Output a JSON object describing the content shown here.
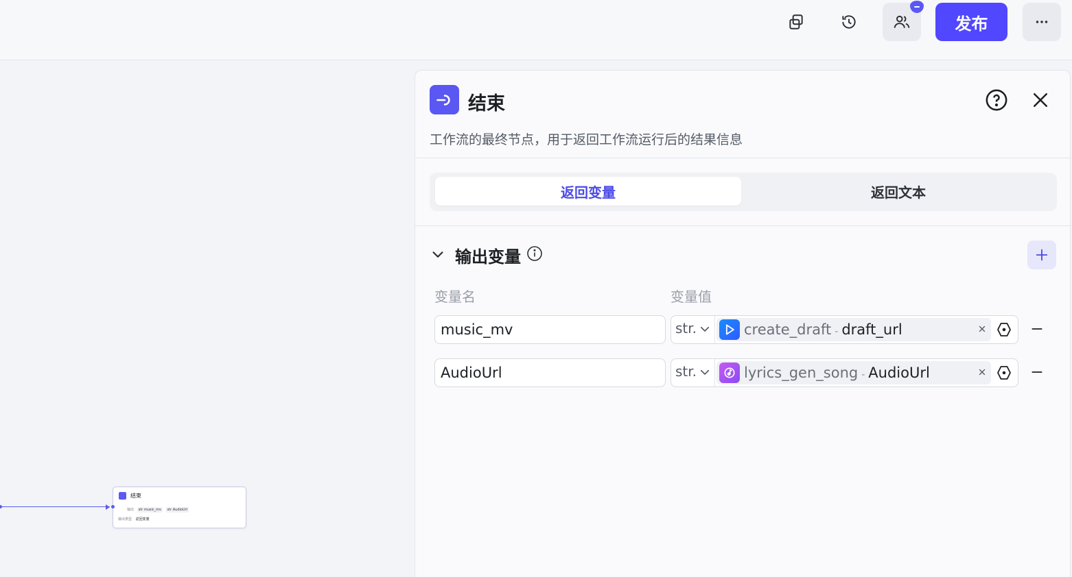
{
  "header": {
    "publish_label": "发布",
    "icons": [
      "copy-icon",
      "history-icon",
      "users-icon",
      "more-icon"
    ]
  },
  "canvas": {
    "mini_node": {
      "title": "结束",
      "output_label": "输出",
      "output_tags": [
        "str music_mv",
        "str AudioUrl"
      ],
      "type_label": "输出类型",
      "type_value": "返回变量"
    }
  },
  "panel": {
    "title": "结束",
    "description": "工作流的最终节点，用于返回工作流运行后的结果信息",
    "tabs": [
      {
        "label": "返回变量",
        "active": true
      },
      {
        "label": "返回文本",
        "active": false
      }
    ],
    "section_title": "输出变量",
    "col_name": "变量名",
    "col_value": "变量值",
    "rows": [
      {
        "name": "music_mv",
        "type": "str.",
        "ref_node": "create_draft",
        "ref_key": "draft_url",
        "icon": "play-app-icon"
      },
      {
        "name": "AudioUrl",
        "type": "str.",
        "ref_node": "lyrics_gen_song",
        "ref_key": "AudioUrl",
        "icon": "music-app-icon"
      }
    ],
    "colors": {
      "accent": "#5147ff",
      "active_tab": "#4c4ae6"
    }
  }
}
